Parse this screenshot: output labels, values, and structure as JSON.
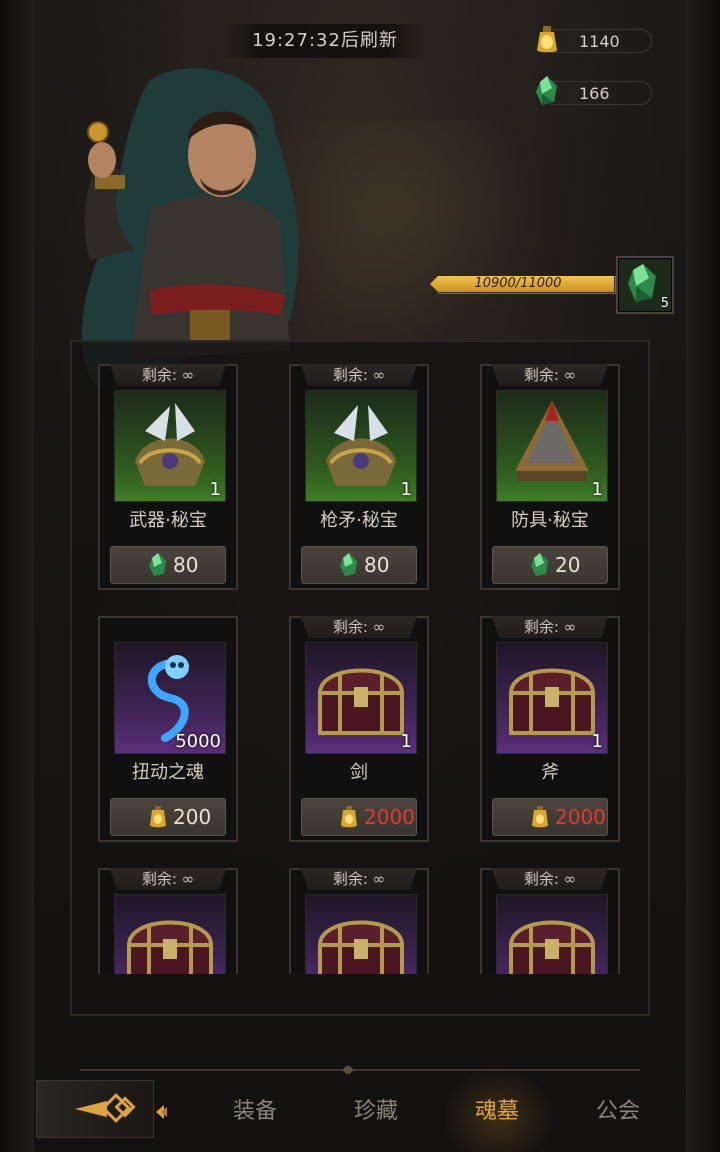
{
  "header": {
    "refresh_timer": "19:27:32后刷新"
  },
  "currencies": {
    "gold": {
      "icon": "gold-potion-icon",
      "amount": "1140"
    },
    "soul_gem": {
      "icon": "green-gem-icon",
      "amount": "166"
    }
  },
  "progress": {
    "text": "10900/11000",
    "fraction": 0.991,
    "reward_icon": "green-gem-icon",
    "reward_count": "5"
  },
  "shop_items": [
    {
      "remain": "剩余: ∞",
      "name": "武器·秘宝",
      "qty": "1",
      "rarity": "green",
      "icon": "weapon-relic-icon",
      "price_icon": "green-gem-icon",
      "price": "80",
      "price_red": false
    },
    {
      "remain": "剩余: ∞",
      "name": "枪矛·秘宝",
      "qty": "1",
      "rarity": "green",
      "icon": "spear-relic-icon",
      "price_icon": "green-gem-icon",
      "price": "80",
      "price_red": false
    },
    {
      "remain": "剩余: ∞",
      "name": "防具·秘宝",
      "qty": "1",
      "rarity": "green",
      "icon": "armor-relic-icon",
      "price_icon": "green-gem-icon",
      "price": "20",
      "price_red": false
    },
    {
      "remain": "",
      "name": "扭动之魂",
      "qty": "5000",
      "rarity": "purple",
      "icon": "blue-soul-icon",
      "price_icon": "gold-potion-icon",
      "price": "200",
      "price_red": false
    },
    {
      "remain": "剩余: ∞",
      "name": "剑",
      "qty": "1",
      "rarity": "purple",
      "icon": "treasure-chest-icon",
      "price_icon": "gold-potion-icon",
      "price": "2000",
      "price_red": true
    },
    {
      "remain": "剩余: ∞",
      "name": "斧",
      "qty": "1",
      "rarity": "purple",
      "icon": "treasure-chest-icon",
      "price_icon": "gold-potion-icon",
      "price": "2000",
      "price_red": true
    },
    {
      "remain": "剩余: ∞",
      "name": "",
      "qty": "",
      "rarity": "purple",
      "icon": "treasure-chest-icon",
      "price_icon": "",
      "price": "",
      "price_red": false
    },
    {
      "remain": "剩余: ∞",
      "name": "",
      "qty": "",
      "rarity": "purple",
      "icon": "treasure-chest-icon",
      "price_icon": "",
      "price": "",
      "price_red": false
    },
    {
      "remain": "剩余: ∞",
      "name": "",
      "qty": "",
      "rarity": "purple",
      "icon": "treasure-chest-icon",
      "price_icon": "",
      "price": "",
      "price_red": false
    }
  ],
  "nav": {
    "back_icon": "double-diamond-arrow-icon",
    "tabs": [
      {
        "label": "装备",
        "active": false
      },
      {
        "label": "珍藏",
        "active": false
      },
      {
        "label": "魂墓",
        "active": true
      },
      {
        "label": "公会",
        "active": false
      }
    ]
  },
  "colors": {
    "accent_gold": "#e0a341",
    "price_red": "#e03a2d",
    "rarity_green": "#3f7d27",
    "rarity_purple": "#5b2f7a"
  }
}
